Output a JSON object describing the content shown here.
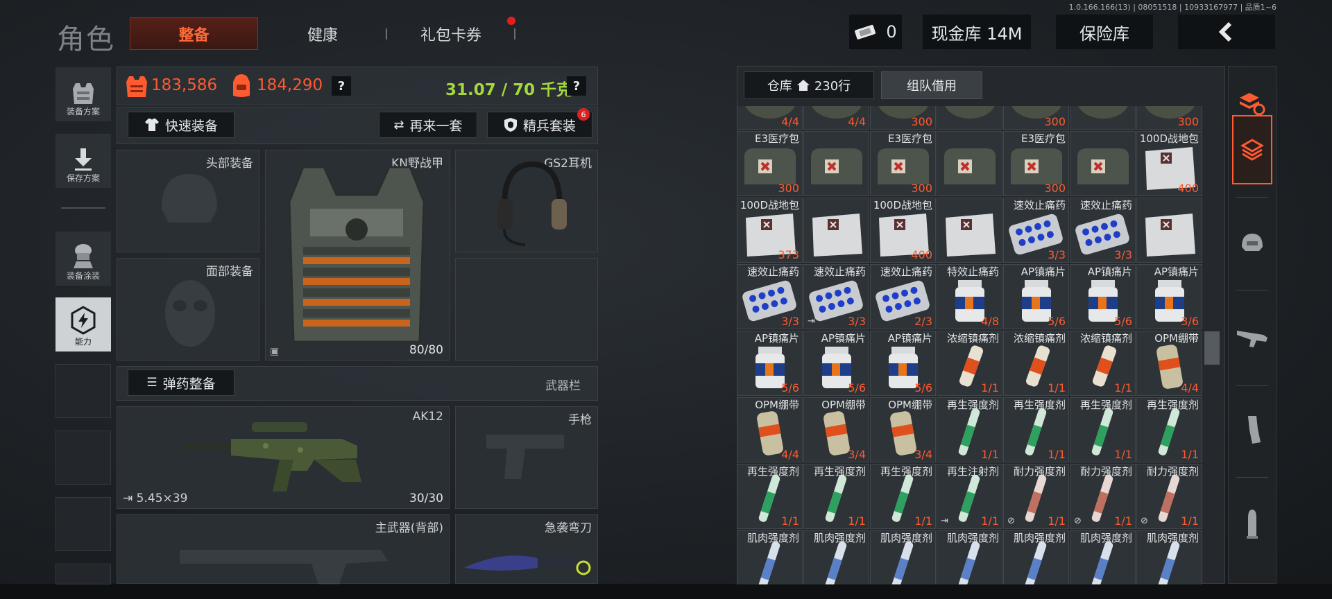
{
  "version": "1.0.166.166(13) | 08051518 | 10933167977 | 品质1~6",
  "nav": {
    "title": "角色",
    "tabs": [
      {
        "label": "整备",
        "active": true
      },
      {
        "label": "健康",
        "active": false
      },
      {
        "label": "礼包卡券",
        "active": false,
        "dot": true
      }
    ],
    "currency_count": "0",
    "cash_vault": "现金库 14M",
    "safe_box": "保险库",
    "back_icon": "chevron-left-icon"
  },
  "sidebar": {
    "items": [
      {
        "label": "装备方案",
        "icon": "vest-icon"
      },
      {
        "label": "保存方案",
        "icon": "download-icon"
      },
      {
        "label": "装备涂装",
        "icon": "soldier-icon"
      },
      {
        "label": "能力",
        "icon": "lightning-icon",
        "active": true
      }
    ]
  },
  "stats": {
    "armor_value": "183,586",
    "backpack_value": "184,290",
    "weight": "31.07 / 70 千克",
    "help": "?"
  },
  "actions": {
    "quick_equip": "快速装备",
    "again": "再来一套",
    "elite_set": "精兵套装",
    "elite_badge": "6",
    "ammo_equip": "弹药整备",
    "weapon_bar": "武器栏"
  },
  "slots": {
    "head": "头部装备",
    "face": "面部装备",
    "vest": "KN野战甲",
    "vest_durability": "80/80",
    "headset": "GS2耳机",
    "primary": "AK12",
    "primary_ammo": "5.45×39",
    "primary_count": "30/30",
    "pistol": "手枪",
    "back_weapon": "主武器(背部)",
    "knife": "急袭弯刀"
  },
  "warehouse": {
    "tab_storage": "仓库",
    "tab_rows": "230行",
    "tab_team": "组队借用",
    "rows": [
      [
        {
          "name": "",
          "count": "4/4",
          "type": "bag"
        },
        {
          "name": "",
          "count": "4/4",
          "type": "bag"
        },
        {
          "name": "",
          "count": "300",
          "type": "bag"
        },
        {
          "name": "",
          "count": "",
          "type": "bag"
        },
        {
          "name": "",
          "count": "300",
          "type": "bag"
        },
        {
          "name": "",
          "count": "",
          "type": "bag"
        },
        {
          "name": "",
          "count": "300",
          "type": "bag"
        }
      ],
      [
        {
          "name": "E3医疗包",
          "count": "300",
          "type": "medkit"
        },
        {
          "name": "",
          "count": "",
          "type": "medkit"
        },
        {
          "name": "E3医疗包",
          "count": "300",
          "type": "medkit"
        },
        {
          "name": "",
          "count": "",
          "type": "medkit"
        },
        {
          "name": "E3医疗包",
          "count": "300",
          "type": "medkit"
        },
        {
          "name": "",
          "count": "",
          "type": "medkit"
        },
        {
          "name": "100D战地包",
          "count": "400",
          "type": "whitebag"
        }
      ],
      [
        {
          "name": "100D战地包",
          "count": "373",
          "type": "whitebag"
        },
        {
          "name": "",
          "count": "",
          "type": "whitebag"
        },
        {
          "name": "100D战地包",
          "count": "400",
          "type": "whitebag"
        },
        {
          "name": "",
          "count": "",
          "type": "whitebag"
        },
        {
          "name": "速效止痛药",
          "count": "3/3",
          "type": "pills"
        },
        {
          "name": "速效止痛药",
          "count": "3/3",
          "type": "pills"
        },
        {
          "name": "",
          "count": "",
          "type": "whitebag"
        }
      ],
      [
        {
          "name": "速效止痛药",
          "count": "3/3",
          "type": "pills"
        },
        {
          "name": "速效止痛药",
          "count": "3/3",
          "type": "pills",
          "flag": "⇥"
        },
        {
          "name": "速效止痛药",
          "count": "2/3",
          "type": "pills"
        },
        {
          "name": "特效止痛药",
          "count": "4/8",
          "type": "bottle"
        },
        {
          "name": "AP镇痛片",
          "count": "5/6",
          "type": "bottle"
        },
        {
          "name": "AP镇痛片",
          "count": "5/6",
          "type": "bottle"
        },
        {
          "name": "AP镇痛片",
          "count": "3/6",
          "type": "bottle"
        }
      ],
      [
        {
          "name": "AP镇痛片",
          "count": "5/6",
          "type": "bottle"
        },
        {
          "name": "AP镇痛片",
          "count": "5/6",
          "type": "bottle"
        },
        {
          "name": "AP镇痛片",
          "count": "5/6",
          "type": "bottle"
        },
        {
          "name": "浓缩镇痛剂",
          "count": "1/1",
          "type": "tube"
        },
        {
          "name": "浓缩镇痛剂",
          "count": "1/1",
          "type": "tube"
        },
        {
          "name": "浓缩镇痛剂",
          "count": "1/1",
          "type": "tube"
        },
        {
          "name": "OPM绷带",
          "count": "4/4",
          "type": "bandage"
        }
      ],
      [
        {
          "name": "OPM绷带",
          "count": "4/4",
          "type": "bandage"
        },
        {
          "name": "OPM绷带",
          "count": "3/4",
          "type": "bandage"
        },
        {
          "name": "OPM绷带",
          "count": "3/4",
          "type": "bandage"
        },
        {
          "name": "再生强度剂",
          "count": "1/1",
          "type": "green"
        },
        {
          "name": "再生强度剂",
          "count": "1/1",
          "type": "green"
        },
        {
          "name": "再生强度剂",
          "count": "1/1",
          "type": "green"
        },
        {
          "name": "再生强度剂",
          "count": "1/1",
          "type": "green"
        }
      ],
      [
        {
          "name": "再生强度剂",
          "count": "1/1",
          "type": "green"
        },
        {
          "name": "再生强度剂",
          "count": "1/1",
          "type": "green"
        },
        {
          "name": "再生强度剂",
          "count": "1/1",
          "type": "green"
        },
        {
          "name": "再生注射剂",
          "count": "1/1",
          "type": "green",
          "flag": "⇥"
        },
        {
          "name": "耐力强度剂",
          "count": "1/1",
          "type": "pink",
          "flag": "⊘"
        },
        {
          "name": "耐力强度剂",
          "count": "1/1",
          "type": "pink",
          "flag": "⊘"
        },
        {
          "name": "耐力强度剂",
          "count": "1/1",
          "type": "pink",
          "flag": "⊘"
        }
      ],
      [
        {
          "name": "肌肉强度剂",
          "count": "",
          "type": "blue"
        },
        {
          "name": "肌肉强度剂",
          "count": "",
          "type": "blue"
        },
        {
          "name": "肌肉强度剂",
          "count": "",
          "type": "blue"
        },
        {
          "name": "肌肉强度剂",
          "count": "",
          "type": "blue"
        },
        {
          "name": "肌肉强度剂",
          "count": "",
          "type": "blue"
        },
        {
          "name": "肌肉强度剂",
          "count": "",
          "type": "blue"
        },
        {
          "name": "肌肉强度剂",
          "count": "",
          "type": "blue"
        }
      ]
    ]
  },
  "rail": {
    "items": [
      "refresh-layers-icon",
      "layers-icon",
      "helmet-icon",
      "rifle-icon",
      "magazine-icon",
      "bullet-icon"
    ]
  },
  "colors": {
    "accent": "#ff5a30",
    "weight_green": "#a4d83c",
    "background": "#1c2024"
  }
}
